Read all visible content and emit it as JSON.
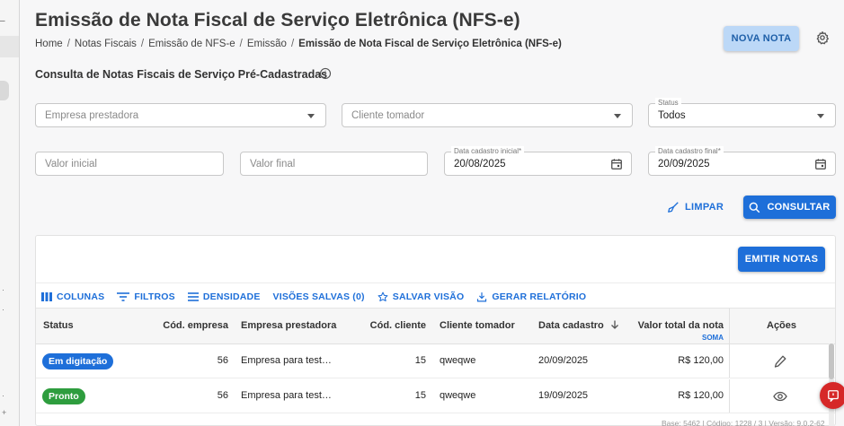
{
  "page": {
    "title": "Emissão de Nota Fiscal de Serviço Eletrônica (NFS-e)",
    "breadcrumb": [
      "Home",
      "Notas Fiscais",
      "Emissão de NFS-e",
      "Emissão",
      "Emissão de Nota Fiscal de Serviço Eletrônica (NFS-e)"
    ],
    "nova_nota_label": "NOVA NOTA",
    "section_title": "Consulta de Notas Fiscais de Serviço Pré-Cadastradas"
  },
  "filters": {
    "empresa_prestadora": {
      "placeholder": "Empresa prestadora"
    },
    "cliente_tomador": {
      "placeholder": "Cliente tomador"
    },
    "status": {
      "label": "Status",
      "value": "Todos"
    },
    "valor_inicial": {
      "placeholder": "Valor inicial"
    },
    "valor_final": {
      "placeholder": "Valor final"
    },
    "data_inicial": {
      "label": "Data cadastro inicial*",
      "value": "20/08/2025"
    },
    "data_final": {
      "label": "Data cadastro final*",
      "value": "20/09/2025"
    },
    "limpar_label": "LIMPAR",
    "consultar_label": "CONSULTAR"
  },
  "grid": {
    "emitir_label": "EMITIR NOTAS",
    "toolbar": {
      "colunas": "COLUNAS",
      "filtros": "FILTROS",
      "densidade": "DENSIDADE",
      "visoes_salvas": "VISÕES SALVAS (0)",
      "salvar_visao": "SALVAR VISÃO",
      "gerar_relatorio": "GERAR RELATÓRIO"
    },
    "columns": {
      "status": "Status",
      "cod_empresa": "Cód. empresa",
      "empresa_prestadora": "Empresa prestadora",
      "cod_cliente": "Cód. cliente",
      "cliente_tomador": "Cliente tomador",
      "data_cadastro": "Data cadastro",
      "valor_total": "Valor total da nota",
      "valor_total_sub": "SOMA",
      "acoes": "Ações"
    },
    "rows": [
      {
        "status": "Em digitação",
        "status_color": "#1e6fd9",
        "cod_empresa": "56",
        "empresa": "Empresa para test…",
        "cod_cliente": "15",
        "cliente": "qweqwe",
        "data": "20/09/2025",
        "valor": "R$ 120,00",
        "action_icon": "pencil-icon"
      },
      {
        "status": "Pronto",
        "status_color": "#2e9d3e",
        "cod_empresa": "56",
        "empresa": "Empresa para test…",
        "cod_cliente": "15",
        "cliente": "qweqwe",
        "data": "19/09/2025",
        "valor": "R$ 120,00",
        "action_icon": "eye-icon"
      }
    ]
  },
  "footer": {
    "text": "Base: 5462 | Código: 1228 / 3 | Versão: 9.0.2-62"
  },
  "colors": {
    "primary": "#1e6fd9",
    "primary_light": "#bcd8f7",
    "fab": "#d62828"
  }
}
